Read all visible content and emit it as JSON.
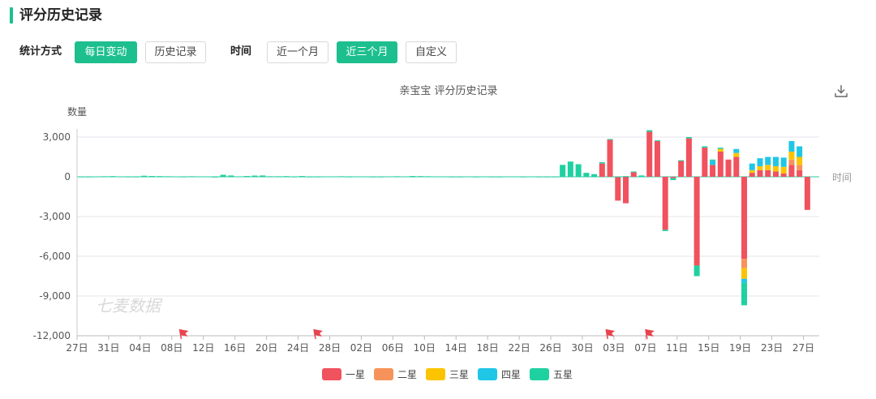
{
  "header": {
    "title": "评分历史记录"
  },
  "controls": {
    "stat_label": "统计方式",
    "stat_buttons": [
      {
        "label": "每日变动",
        "active": true
      },
      {
        "label": "历史记录",
        "active": false
      }
    ],
    "time_label": "时间",
    "time_buttons": [
      {
        "label": "近一个月",
        "active": false
      },
      {
        "label": "近三个月",
        "active": true
      },
      {
        "label": "自定义",
        "active": false
      }
    ]
  },
  "icons": {
    "download": "download-icon"
  },
  "colors": {
    "accent": "#1dbf8e",
    "flag": "#e8434f"
  },
  "chart_data": {
    "type": "bar",
    "stacked": true,
    "title": "亲宝宝 评分历史记录",
    "ylabel": "数量",
    "xlabel": "时间",
    "ylim": [
      -12000,
      3000
    ],
    "yticks": [
      3000,
      0,
      -3000,
      -6000,
      -9000,
      -12000
    ],
    "ytick_labels": [
      "3,000",
      "0",
      "-3,000",
      "-6,000",
      "-9,000",
      "-12,000"
    ],
    "grid": true,
    "legend_position": "bottom-center",
    "watermark": "七麦数据",
    "categories": [
      "27日",
      "28日",
      "29日",
      "30日",
      "31日",
      "01日",
      "02日",
      "03日",
      "04日",
      "05日",
      "06日",
      "07日",
      "08日",
      "09日",
      "10日",
      "11日",
      "12日",
      "13日",
      "14日",
      "15日",
      "16日",
      "17日",
      "18日",
      "19日",
      "20日",
      "21日",
      "22日",
      "23日",
      "24日",
      "25日",
      "26日",
      "27日",
      "28日",
      "29日",
      "30日",
      "31日",
      "01日",
      "02日",
      "03日",
      "04日",
      "05日",
      "06日",
      "07日",
      "08日",
      "09日",
      "10日",
      "11日",
      "12日",
      "13日",
      "14日",
      "15日",
      "16日",
      "17日",
      "18日",
      "19日",
      "20日",
      "21日",
      "22日",
      "23日",
      "24日",
      "25日",
      "26日",
      "27日",
      "28日",
      "29日",
      "30日",
      "31日",
      "01日",
      "02日",
      "03日",
      "04日",
      "05日",
      "06日",
      "07日",
      "08日",
      "09日",
      "10日",
      "11日",
      "12日",
      "13日",
      "14日",
      "15日",
      "16日",
      "17日",
      "18日",
      "19日",
      "20日",
      "21日",
      "22日",
      "23日",
      "24日",
      "25日",
      "26日",
      "27日"
    ],
    "xtick_labels": [
      "27日",
      "31日",
      "04日",
      "08日",
      "12日",
      "16日",
      "20日",
      "24日",
      "28日",
      "02日",
      "06日",
      "10日",
      "14日",
      "18日",
      "22日",
      "26日",
      "30日",
      "03日",
      "07日",
      "11日",
      "15日",
      "19日",
      "23日",
      "27日"
    ],
    "xtick_every": 4,
    "series": [
      {
        "name": "一星",
        "color": "#f0525e",
        "values": [
          0,
          0,
          0,
          0,
          0,
          0,
          0,
          0,
          0,
          0,
          0,
          0,
          0,
          0,
          0,
          0,
          0,
          0,
          0,
          0,
          0,
          0,
          0,
          0,
          0,
          0,
          0,
          0,
          0,
          0,
          0,
          0,
          0,
          0,
          0,
          0,
          0,
          0,
          0,
          0,
          0,
          0,
          0,
          0,
          0,
          0,
          0,
          0,
          0,
          0,
          0,
          0,
          0,
          0,
          0,
          0,
          0,
          0,
          0,
          0,
          0,
          0,
          0,
          0,
          0,
          0,
          1000,
          2800,
          -1800,
          -2000,
          350,
          0,
          3400,
          2700,
          -4000,
          -100,
          1200,
          2900,
          -6700,
          2200,
          900,
          1900,
          1300,
          1500,
          -6200,
          300,
          500,
          500,
          400,
          250,
          900,
          500,
          -2500,
          0
        ]
      },
      {
        "name": "二星",
        "color": "#f7935a",
        "values": [
          0,
          0,
          0,
          0,
          0,
          0,
          0,
          0,
          0,
          0,
          0,
          0,
          0,
          0,
          0,
          0,
          0,
          0,
          0,
          0,
          0,
          0,
          0,
          0,
          0,
          0,
          0,
          0,
          0,
          0,
          0,
          0,
          0,
          0,
          0,
          0,
          0,
          0,
          0,
          0,
          0,
          0,
          0,
          0,
          0,
          0,
          0,
          0,
          0,
          0,
          0,
          0,
          0,
          0,
          0,
          0,
          0,
          0,
          0,
          0,
          0,
          0,
          0,
          0,
          0,
          0,
          0,
          0,
          0,
          0,
          0,
          0,
          0,
          0,
          0,
          0,
          0,
          0,
          0,
          0,
          0,
          0,
          0,
          0,
          -700,
          0,
          0,
          0,
          0,
          0,
          400,
          400,
          0,
          0
        ]
      },
      {
        "name": "三星",
        "color": "#fcc400",
        "values": [
          0,
          0,
          0,
          0,
          0,
          0,
          0,
          0,
          0,
          0,
          0,
          0,
          0,
          0,
          0,
          0,
          0,
          0,
          0,
          0,
          0,
          0,
          0,
          0,
          0,
          0,
          0,
          0,
          0,
          0,
          0,
          0,
          0,
          0,
          0,
          0,
          0,
          0,
          0,
          0,
          0,
          0,
          0,
          0,
          0,
          0,
          0,
          0,
          0,
          0,
          0,
          0,
          0,
          0,
          0,
          0,
          0,
          0,
          0,
          0,
          0,
          0,
          0,
          0,
          0,
          0,
          0,
          0,
          0,
          0,
          0,
          0,
          0,
          0,
          0,
          0,
          0,
          0,
          0,
          0,
          0,
          200,
          0,
          300,
          -800,
          200,
          300,
          400,
          400,
          500,
          600,
          600,
          0,
          0
        ]
      },
      {
        "name": "四星",
        "color": "#20c6e6",
        "values": [
          0,
          0,
          0,
          0,
          0,
          0,
          0,
          0,
          0,
          0,
          0,
          0,
          0,
          0,
          0,
          0,
          0,
          0,
          0,
          0,
          0,
          0,
          0,
          0,
          0,
          0,
          0,
          0,
          0,
          0,
          0,
          0,
          0,
          0,
          0,
          0,
          0,
          0,
          0,
          0,
          0,
          0,
          0,
          0,
          0,
          0,
          0,
          0,
          0,
          0,
          0,
          0,
          0,
          0,
          0,
          0,
          0,
          0,
          0,
          0,
          0,
          0,
          0,
          0,
          0,
          0,
          0,
          0,
          0,
          0,
          0,
          0,
          0,
          0,
          0,
          0,
          0,
          0,
          0,
          0,
          300,
          0,
          0,
          300,
          -300,
          500,
          600,
          600,
          700,
          700,
          800,
          800,
          0,
          0
        ]
      },
      {
        "name": "五星",
        "color": "#1fd1a0",
        "values": [
          20,
          20,
          30,
          40,
          50,
          30,
          20,
          20,
          80,
          60,
          50,
          40,
          30,
          20,
          40,
          30,
          30,
          10,
          150,
          100,
          30,
          60,
          90,
          100,
          40,
          40,
          50,
          20,
          60,
          20,
          20,
          30,
          30,
          40,
          20,
          30,
          30,
          20,
          20,
          30,
          40,
          30,
          60,
          50,
          40,
          30,
          30,
          20,
          20,
          30,
          20,
          30,
          20,
          20,
          30,
          30,
          20,
          30,
          20,
          20,
          20,
          900,
          1150,
          950,
          300,
          200,
          100,
          50,
          30,
          50,
          50,
          100,
          120,
          50,
          -100,
          -150,
          50,
          100,
          -800,
          100,
          100,
          100,
          0,
          0,
          -1700,
          0,
          0,
          0,
          0,
          0,
          0,
          0,
          0,
          0
        ]
      }
    ]
  }
}
